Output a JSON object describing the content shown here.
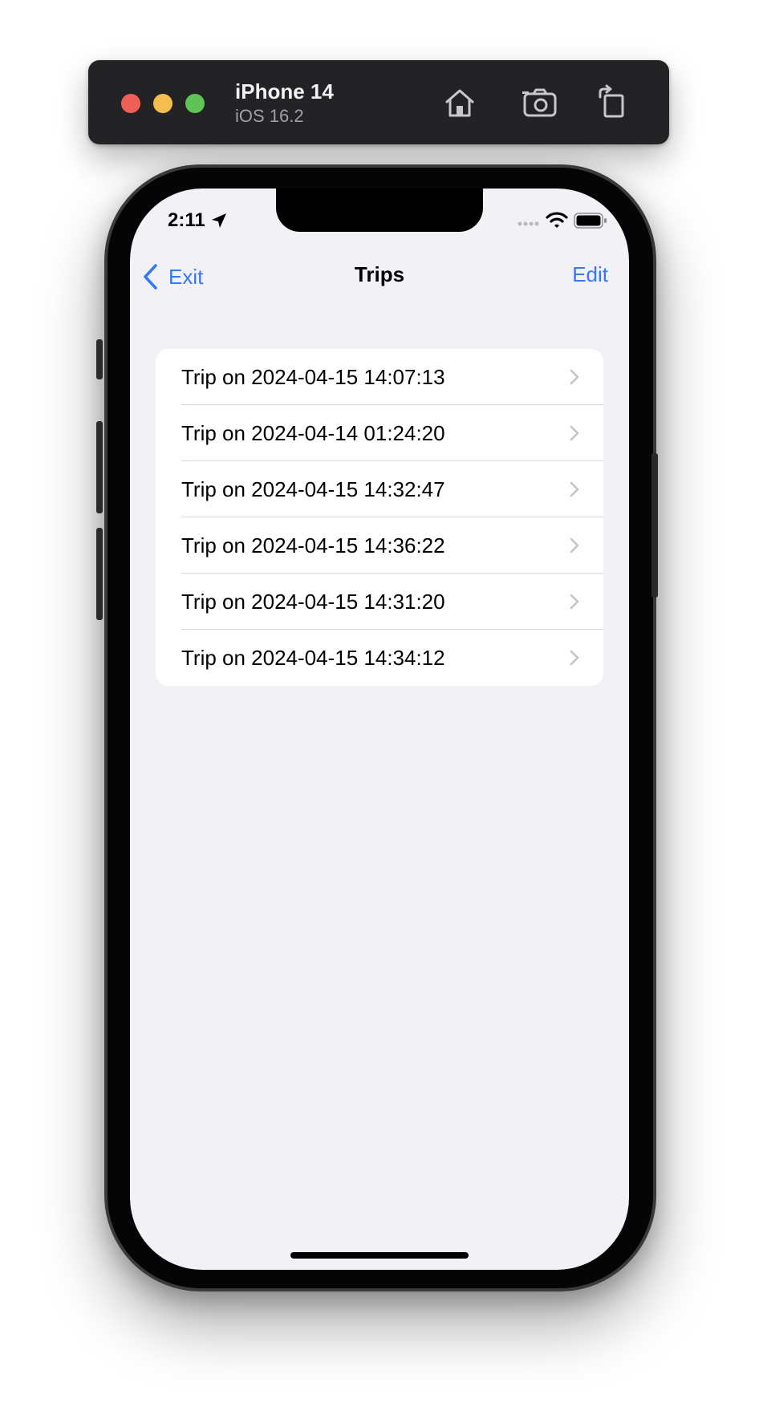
{
  "simulator": {
    "device_name": "iPhone 14",
    "os_version": "iOS 16.2",
    "buttons": {
      "home": "home-icon",
      "screenshot": "camera-icon",
      "rotate": "rotate-icon"
    }
  },
  "status_bar": {
    "time": "2:11"
  },
  "nav": {
    "back_label": "Exit",
    "title": "Trips",
    "edit_label": "Edit"
  },
  "trips": [
    {
      "label": "Trip on 2024-04-15 14:07:13"
    },
    {
      "label": "Trip on 2024-04-14 01:24:20"
    },
    {
      "label": "Trip on 2024-04-15 14:32:47"
    },
    {
      "label": "Trip on 2024-04-15 14:36:22"
    },
    {
      "label": "Trip on 2024-04-15 14:31:20"
    },
    {
      "label": "Trip on 2024-04-15 14:34:12"
    }
  ],
  "colors": {
    "accent": "#3478f6",
    "screen_background": "#f2f1f6",
    "toolbar_background": "#232325"
  }
}
